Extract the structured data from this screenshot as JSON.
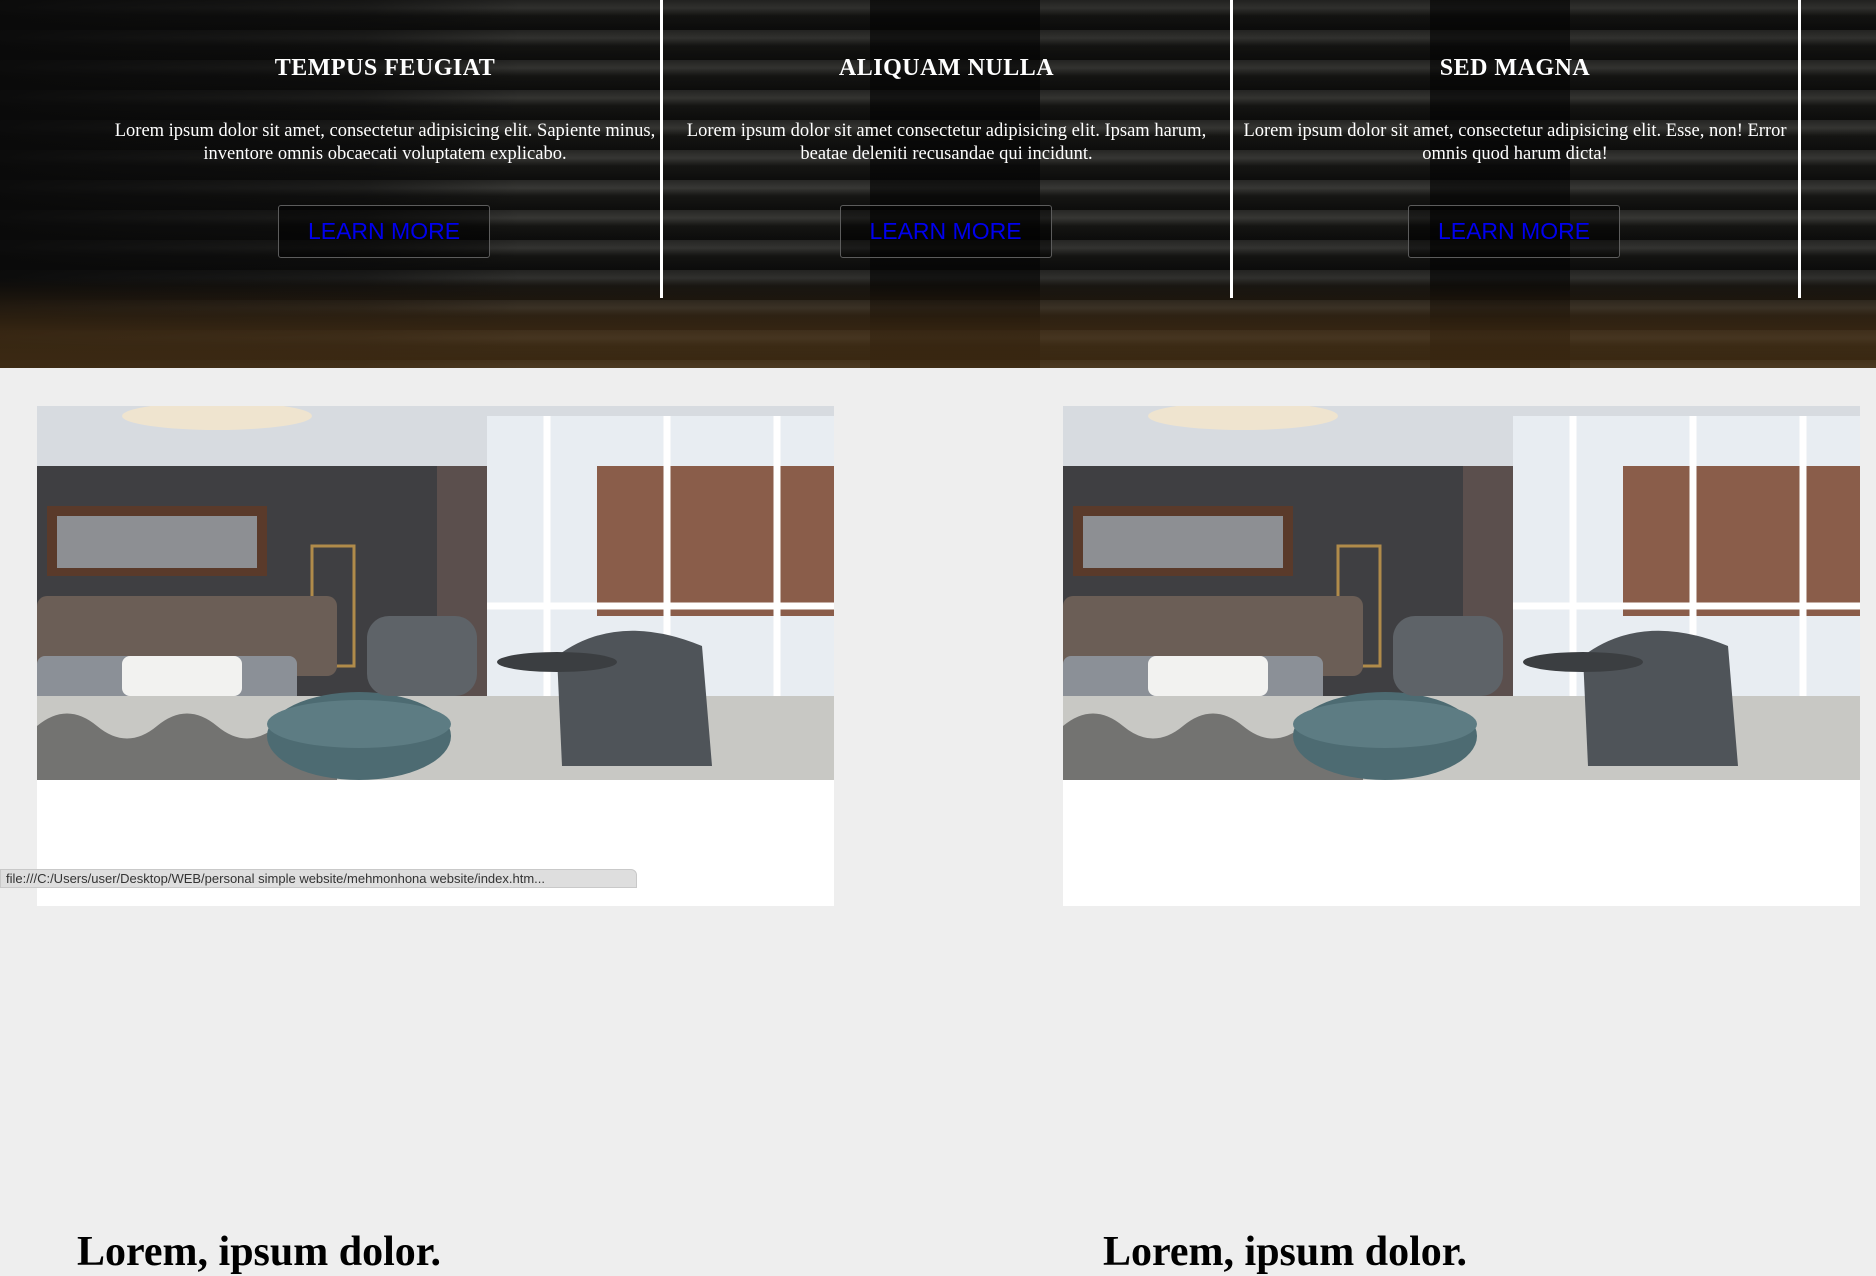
{
  "features": [
    {
      "title": "TEMPUS FEUGIAT",
      "text": "Lorem ipsum dolor sit amet, consectetur adipisicing elit. Sapiente minus, inventore omnis obcaecati voluptatem explicabo.",
      "button": "LEARN MORE"
    },
    {
      "title": "ALIQUAM NULLA",
      "text": "Lorem ipsum dolor sit amet consectetur adipisicing elit. Ipsam harum, beatae deleniti recusandae qui incidunt.",
      "button": "LEARN MORE"
    },
    {
      "title": "SED MAGNA",
      "text": "Lorem ipsum dolor sit amet, consectetur adipisicing elit. Esse, non! Error omnis quod harum dicta!",
      "button": "LEARN MORE"
    }
  ],
  "cards": [
    {
      "title": "Lorem, ipsum dolor."
    },
    {
      "title": "Lorem, ipsum dolor."
    }
  ],
  "status_url": "file:///C:/Users/user/Desktop/WEB/personal simple website/mehmonhona website/index.htm...",
  "colors": {
    "link": "#0000ee",
    "page_bg": "#eeeeee",
    "divider": "#ffffff"
  },
  "icons": {
    "card_photo": "living-room-photo"
  }
}
